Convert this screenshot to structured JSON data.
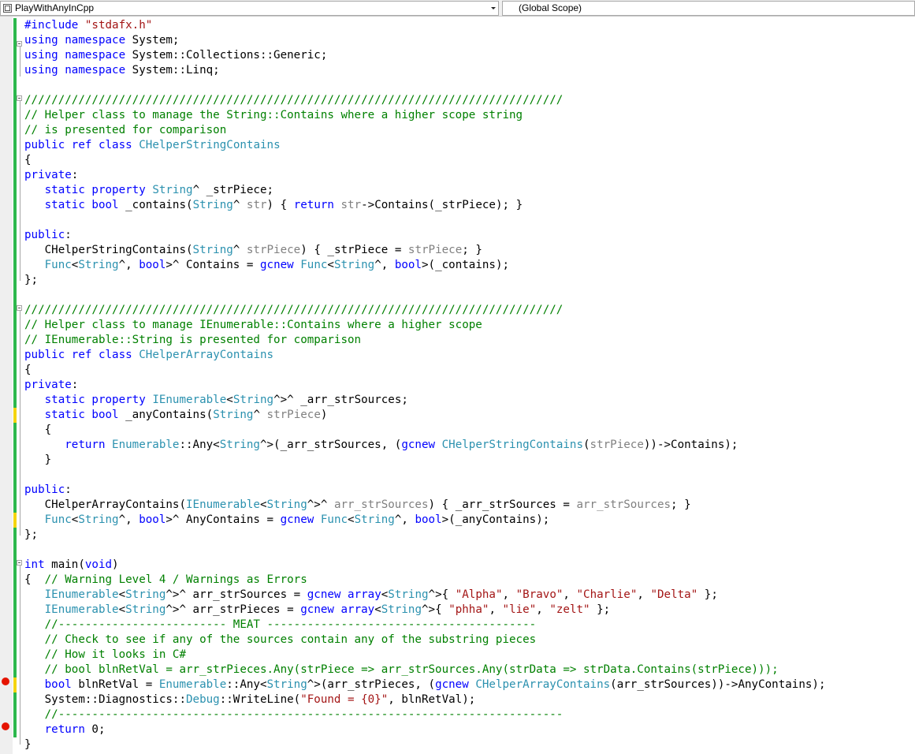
{
  "navbar": {
    "project": "PlayWithAnyInCpp",
    "scope": "(Global Scope)",
    "icons": [
      "project-icon",
      "dropdown-arrow-icon"
    ]
  },
  "colors": {
    "keyword": "#0000ff",
    "type": "#2b91af",
    "comment": "#008000",
    "string": "#a31515",
    "parameter": "#808080",
    "changebar_saved": "#2db84d",
    "changebar_unsaved": "#f5d40f",
    "breakpoint": "#e51400"
  },
  "breakpoint_lines": [
    45,
    48
  ],
  "lines": [
    [
      [
        "k",
        "#include"
      ],
      [
        "",
        " "
      ],
      [
        "s",
        "\"stdafx.h\""
      ]
    ],
    [
      [
        "k",
        "using"
      ],
      [
        "",
        " "
      ],
      [
        "k",
        "namespace"
      ],
      [
        "",
        " System;"
      ]
    ],
    [
      [
        "k",
        "using"
      ],
      [
        "",
        " "
      ],
      [
        "k",
        "namespace"
      ],
      [
        "",
        " System::Collections::Generic;"
      ]
    ],
    [
      [
        "k",
        "using"
      ],
      [
        "",
        " "
      ],
      [
        "k",
        "namespace"
      ],
      [
        "",
        " System::Linq;"
      ]
    ],
    [],
    [
      [
        "c",
        "////////////////////////////////////////////////////////////////////////////////"
      ]
    ],
    [
      [
        "c",
        "// Helper class to manage the String::Contains where a higher scope string"
      ]
    ],
    [
      [
        "c",
        "// is presented for comparison"
      ]
    ],
    [
      [
        "k",
        "public"
      ],
      [
        "",
        " "
      ],
      [
        "k",
        "ref"
      ],
      [
        "",
        " "
      ],
      [
        "k",
        "class"
      ],
      [
        "",
        " "
      ],
      [
        "t",
        "CHelperStringContains"
      ]
    ],
    [
      [
        "",
        "{"
      ]
    ],
    [
      [
        "k",
        "private"
      ],
      [
        "",
        ":"
      ]
    ],
    [
      [
        "",
        "   "
      ],
      [
        "k",
        "static"
      ],
      [
        "",
        " "
      ],
      [
        "k",
        "property"
      ],
      [
        "",
        " "
      ],
      [
        "t",
        "String"
      ],
      [
        "",
        "^ _strPiece;"
      ]
    ],
    [
      [
        "",
        "   "
      ],
      [
        "k",
        "static"
      ],
      [
        "",
        " "
      ],
      [
        "k",
        "bool"
      ],
      [
        "",
        " _contains("
      ],
      [
        "t",
        "String"
      ],
      [
        "",
        "^ "
      ],
      [
        "g",
        "str"
      ],
      [
        "",
        ") { "
      ],
      [
        "k",
        "return"
      ],
      [
        "",
        " "
      ],
      [
        "g",
        "str"
      ],
      [
        "",
        "->Contains(_strPiece); }"
      ]
    ],
    [],
    [
      [
        "k",
        "public"
      ],
      [
        "",
        ":"
      ]
    ],
    [
      [
        "",
        "   CHelperStringContains("
      ],
      [
        "t",
        "String"
      ],
      [
        "",
        "^ "
      ],
      [
        "g",
        "strPiece"
      ],
      [
        "",
        ") { _strPiece = "
      ],
      [
        "g",
        "strPiece"
      ],
      [
        "",
        "; }"
      ]
    ],
    [
      [
        "",
        "   "
      ],
      [
        "t",
        "Func"
      ],
      [
        "",
        "<"
      ],
      [
        "t",
        "String"
      ],
      [
        "",
        "^, "
      ],
      [
        "k",
        "bool"
      ],
      [
        "",
        ">^ Contains = "
      ],
      [
        "k",
        "gcnew"
      ],
      [
        "",
        " "
      ],
      [
        "t",
        "Func"
      ],
      [
        "",
        "<"
      ],
      [
        "t",
        "String"
      ],
      [
        "",
        "^, "
      ],
      [
        "k",
        "bool"
      ],
      [
        "",
        ">(_contains);"
      ]
    ],
    [
      [
        "",
        "};"
      ]
    ],
    [],
    [
      [
        "c",
        "////////////////////////////////////////////////////////////////////////////////"
      ]
    ],
    [
      [
        "c",
        "// Helper class to manage IEnumerable::Contains where a higher scope"
      ]
    ],
    [
      [
        "c",
        "// IEnumerable::String is presented for comparison"
      ]
    ],
    [
      [
        "k",
        "public"
      ],
      [
        "",
        " "
      ],
      [
        "k",
        "ref"
      ],
      [
        "",
        " "
      ],
      [
        "k",
        "class"
      ],
      [
        "",
        " "
      ],
      [
        "t",
        "CHelperArrayContains"
      ]
    ],
    [
      [
        "",
        "{"
      ]
    ],
    [
      [
        "k",
        "private"
      ],
      [
        "",
        ":"
      ]
    ],
    [
      [
        "",
        "   "
      ],
      [
        "k",
        "static"
      ],
      [
        "",
        " "
      ],
      [
        "k",
        "property"
      ],
      [
        "",
        " "
      ],
      [
        "t",
        "IEnumerable"
      ],
      [
        "",
        "<"
      ],
      [
        "t",
        "String"
      ],
      [
        "",
        "^>^ _arr_strSources;"
      ]
    ],
    [
      [
        "",
        "   "
      ],
      [
        "k",
        "static"
      ],
      [
        "",
        " "
      ],
      [
        "k",
        "bool"
      ],
      [
        "",
        " _anyContains("
      ],
      [
        "t",
        "String"
      ],
      [
        "",
        "^ "
      ],
      [
        "g",
        "strPiece"
      ],
      [
        "",
        ")"
      ]
    ],
    [
      [
        "",
        "   {"
      ]
    ],
    [
      [
        "",
        "      "
      ],
      [
        "k",
        "return"
      ],
      [
        "",
        " "
      ],
      [
        "t",
        "Enumerable"
      ],
      [
        "",
        "::Any<"
      ],
      [
        "t",
        "String"
      ],
      [
        "",
        "^>(_arr_strSources, ("
      ],
      [
        "k",
        "gcnew"
      ],
      [
        "",
        " "
      ],
      [
        "t",
        "CHelperStringContains"
      ],
      [
        "",
        "("
      ],
      [
        "g",
        "strPiece"
      ],
      [
        "",
        "))->Contains);"
      ]
    ],
    [
      [
        "",
        "   }"
      ]
    ],
    [],
    [
      [
        "k",
        "public"
      ],
      [
        "",
        ":"
      ]
    ],
    [
      [
        "",
        "   CHelperArrayContains("
      ],
      [
        "t",
        "IEnumerable"
      ],
      [
        "",
        "<"
      ],
      [
        "t",
        "String"
      ],
      [
        "",
        "^>^ "
      ],
      [
        "g",
        "arr_strSources"
      ],
      [
        "",
        ") { _arr_strSources = "
      ],
      [
        "g",
        "arr_strSources"
      ],
      [
        "",
        "; }"
      ]
    ],
    [
      [
        "",
        "   "
      ],
      [
        "t",
        "Func"
      ],
      [
        "",
        "<"
      ],
      [
        "t",
        "String"
      ],
      [
        "",
        "^, "
      ],
      [
        "k",
        "bool"
      ],
      [
        "",
        ">^ AnyContains = "
      ],
      [
        "k",
        "gcnew"
      ],
      [
        "",
        " "
      ],
      [
        "t",
        "Func"
      ],
      [
        "",
        "<"
      ],
      [
        "t",
        "String"
      ],
      [
        "",
        "^, "
      ],
      [
        "k",
        "bool"
      ],
      [
        "",
        ">(_anyContains);"
      ]
    ],
    [
      [
        "",
        "};"
      ]
    ],
    [],
    [
      [
        "k",
        "int"
      ],
      [
        "",
        " main("
      ],
      [
        "k",
        "void"
      ],
      [
        "",
        ")"
      ]
    ],
    [
      [
        "",
        "{  "
      ],
      [
        "c",
        "// Warning Level 4 / Warnings as Errors"
      ]
    ],
    [
      [
        "",
        "   "
      ],
      [
        "t",
        "IEnumerable"
      ],
      [
        "",
        "<"
      ],
      [
        "t",
        "String"
      ],
      [
        "",
        "^>^ arr_strSources = "
      ],
      [
        "k",
        "gcnew"
      ],
      [
        "",
        " "
      ],
      [
        "k",
        "array"
      ],
      [
        "",
        "<"
      ],
      [
        "t",
        "String"
      ],
      [
        "",
        "^>{ "
      ],
      [
        "s",
        "\"Alpha\""
      ],
      [
        "",
        ", "
      ],
      [
        "s",
        "\"Bravo\""
      ],
      [
        "",
        ", "
      ],
      [
        "s",
        "\"Charlie\""
      ],
      [
        "",
        ", "
      ],
      [
        "s",
        "\"Delta\""
      ],
      [
        "",
        " };"
      ]
    ],
    [
      [
        "",
        "   "
      ],
      [
        "t",
        "IEnumerable"
      ],
      [
        "",
        "<"
      ],
      [
        "t",
        "String"
      ],
      [
        "",
        "^>^ arr_strPieces = "
      ],
      [
        "k",
        "gcnew"
      ],
      [
        "",
        " "
      ],
      [
        "k",
        "array"
      ],
      [
        "",
        "<"
      ],
      [
        "t",
        "String"
      ],
      [
        "",
        "^>{ "
      ],
      [
        "s",
        "\"phha\""
      ],
      [
        "",
        ", "
      ],
      [
        "s",
        "\"lie\""
      ],
      [
        "",
        ", "
      ],
      [
        "s",
        "\"zelt\""
      ],
      [
        "",
        " };"
      ]
    ],
    [
      [
        "",
        "   "
      ],
      [
        "c",
        "//------------------------- MEAT ----------------------------------------"
      ]
    ],
    [
      [
        "",
        "   "
      ],
      [
        "c",
        "// Check to see if any of the sources contain any of the substring pieces"
      ]
    ],
    [
      [
        "",
        "   "
      ],
      [
        "c",
        "// How it looks in C#"
      ]
    ],
    [
      [
        "",
        "   "
      ],
      [
        "c",
        "// bool blnRetVal = arr_strPieces.Any(strPiece => arr_strSources.Any(strData => strData.Contains(strPiece)));"
      ]
    ],
    [
      [
        "",
        "   "
      ],
      [
        "k",
        "bool"
      ],
      [
        "",
        " blnRetVal = "
      ],
      [
        "t",
        "Enumerable"
      ],
      [
        "",
        "::Any<"
      ],
      [
        "t",
        "String"
      ],
      [
        "",
        "^>(arr_strPieces, ("
      ],
      [
        "k",
        "gcnew"
      ],
      [
        "",
        " "
      ],
      [
        "t",
        "CHelperArrayContains"
      ],
      [
        "",
        "(arr_strSources))->AnyContains);"
      ]
    ],
    [
      [
        "",
        "   System::Diagnostics::"
      ],
      [
        "t",
        "Debug"
      ],
      [
        "",
        "::WriteLine("
      ],
      [
        "s",
        "\"Found = {0}\""
      ],
      [
        "",
        ", blnRetVal);"
      ]
    ],
    [
      [
        "",
        "   "
      ],
      [
        "c",
        "//---------------------------------------------------------------------------"
      ]
    ],
    [
      [
        "",
        "   "
      ],
      [
        "k",
        "return"
      ],
      [
        "",
        " 0;"
      ]
    ],
    [
      [
        "",
        "}"
      ]
    ]
  ]
}
